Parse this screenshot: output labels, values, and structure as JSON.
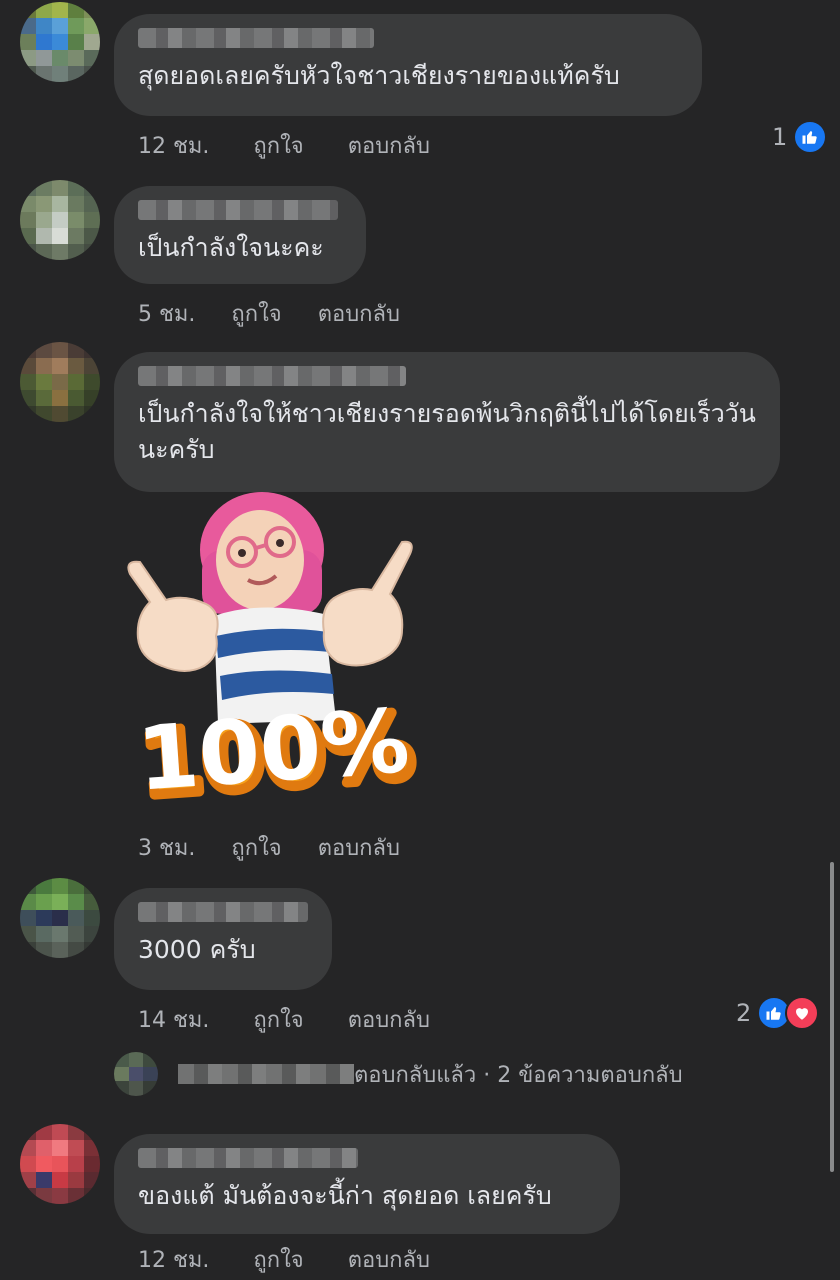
{
  "comments": [
    {
      "text": "สุดยอดเลยครับหัวใจชาวเชียงรายของแท้ครับ",
      "time": "12 ชม.",
      "like_label": "ถูกใจ",
      "reply_label": "ตอบกลับ",
      "reaction_count": "1",
      "reactions": [
        "like-icon"
      ]
    },
    {
      "text": "เป็นกำลังใจนะคะ",
      "time": "5 ชม.",
      "like_label": "ถูกใจ",
      "reply_label": "ตอบกลับ"
    },
    {
      "text": "เป็นกำลังใจให้ชาวเชียงรายรอดพ้นวิกฤตินี้ไปได้โดยเร็ววันนะครับ",
      "sticker": {
        "name": "thumbs-up-100-percent-sticker",
        "caption": "100%"
      },
      "time": "3 ชม.",
      "like_label": "ถูกใจ",
      "reply_label": "ตอบกลับ"
    },
    {
      "text": "3000 ครับ",
      "time": "14 ชม.",
      "like_label": "ถูกใจ",
      "reply_label": "ตอบกลับ",
      "reaction_count": "2",
      "reactions": [
        "like-icon",
        "love-icon"
      ],
      "replies_summary": "ตอบกลับแล้ว · 2 ข้อความตอบกลับ"
    },
    {
      "text": "ของแต้ มันต้องจะนี้ก่า สุดยอด เลยครับ",
      "time": "12 ชม.",
      "like_label": "ถูกใจ",
      "reply_label": "ตอบกลับ"
    }
  ],
  "colors": {
    "background": "#252526",
    "bubble": "#3a3b3c",
    "like_blue": "#1877f2",
    "love_red": "#f33e58"
  }
}
